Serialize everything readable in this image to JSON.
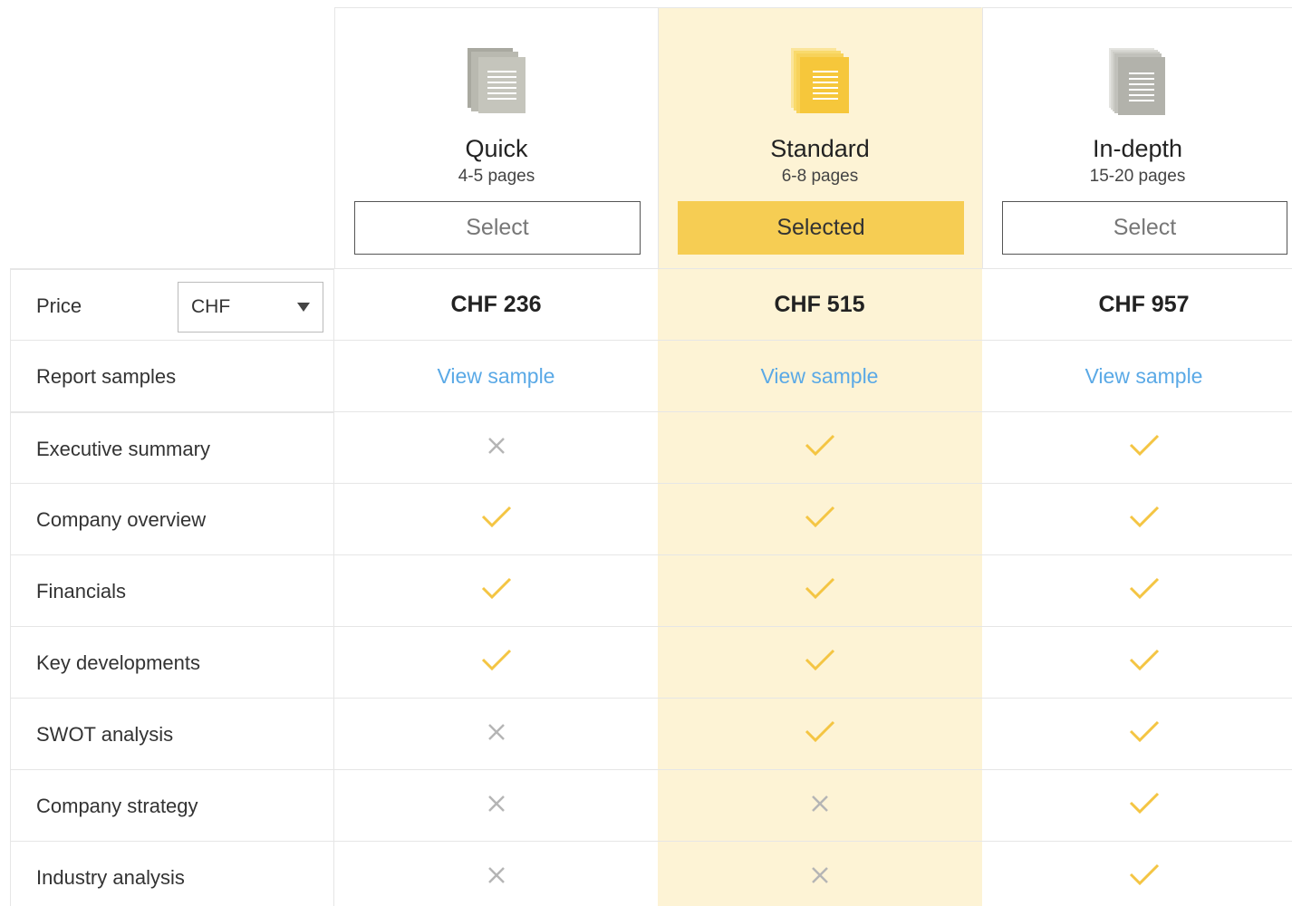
{
  "plans": [
    {
      "name": "Quick",
      "pages": "4-5 pages",
      "button": "Select",
      "selected": false,
      "price": "CHF 236",
      "sample": "View sample",
      "icon": "document-gray-icon"
    },
    {
      "name": "Standard",
      "pages": "6-8 pages",
      "button": "Selected",
      "selected": true,
      "price": "CHF 515",
      "sample": "View sample",
      "icon": "document-yellow-icon"
    },
    {
      "name": "In-depth",
      "pages": "15-20 pages",
      "button": "Select",
      "selected": false,
      "price": "CHF 957",
      "sample": "View sample",
      "icon": "document-stack-gray-icon"
    }
  ],
  "price_row": {
    "label": "Price",
    "currency": "CHF"
  },
  "samples_row": {
    "label": "Report samples"
  },
  "features": [
    {
      "label": "Executive summary",
      "included": [
        false,
        true,
        true
      ]
    },
    {
      "label": "Company overview",
      "included": [
        true,
        true,
        true
      ]
    },
    {
      "label": "Financials",
      "included": [
        true,
        true,
        true
      ]
    },
    {
      "label": "Key developments",
      "included": [
        true,
        true,
        true
      ]
    },
    {
      "label": "SWOT analysis",
      "included": [
        false,
        true,
        true
      ]
    },
    {
      "label": "Company strategy",
      "included": [
        false,
        false,
        true
      ]
    },
    {
      "label": "Industry analysis",
      "included": [
        false,
        false,
        true
      ]
    }
  ],
  "colors": {
    "accent": "#f6cd53",
    "highlight_bg": "#fdf3d5",
    "link": "#5aa9e6",
    "check": "#f4c543",
    "cross": "#b5b5b5"
  }
}
